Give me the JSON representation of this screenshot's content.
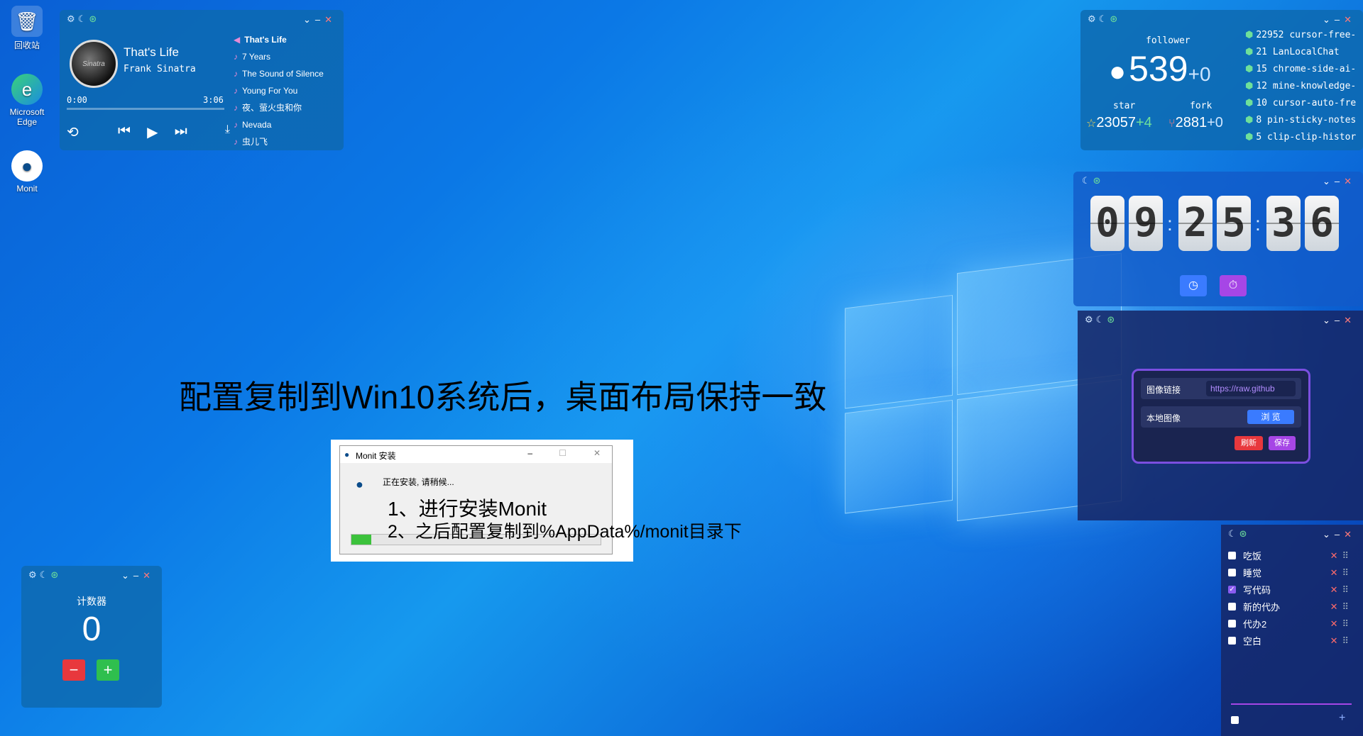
{
  "desktop_icons": [
    {
      "label": "回收站",
      "glyph": "🗑"
    },
    {
      "label": "Microsoft Edge",
      "glyph": "e"
    },
    {
      "label": "Monit",
      "glyph": "●"
    }
  ],
  "music": {
    "title": "That's Life",
    "artist": "Frank Sinatra",
    "album_text": "Sinatra",
    "time_current": "0:00",
    "time_total": "3:06",
    "progress": 0,
    "playlist": [
      "That's Life",
      "7 Years",
      "The Sound of Silence",
      "Young For You",
      "夜、萤火虫和你",
      "Nevada",
      "虫儿飞"
    ],
    "controls": [
      "repeat-icon",
      "previous-icon",
      "play-icon",
      "next-icon",
      "download-icon"
    ]
  },
  "github": {
    "follower_label": "follower",
    "follower_count": "539",
    "follower_delta": "+0",
    "star_label": "star",
    "star_count": "23057",
    "star_delta": "+4",
    "fork_label": "fork",
    "fork_count": "2881",
    "fork_delta": "+0",
    "repos": [
      {
        "stars": "22952",
        "name": "cursor-free-"
      },
      {
        "stars": "21",
        "name": "LanLocalChat"
      },
      {
        "stars": "15",
        "name": "chrome-side-ai-"
      },
      {
        "stars": "12",
        "name": "mine-knowledge-"
      },
      {
        "stars": "10",
        "name": "cursor-auto-fre"
      },
      {
        "stars": "8",
        "name": "pin-sticky-notes"
      },
      {
        "stars": "5",
        "name": "clip-clip-histor"
      }
    ]
  },
  "clock": {
    "digits": [
      "0",
      "9",
      "2",
      "5",
      "3",
      "6"
    ],
    "buttons": [
      "clock-icon",
      "timer-icon"
    ]
  },
  "image_widget": {
    "url_label": "图像链接",
    "url_value": "https://raw.github",
    "local_label": "本地图像",
    "browse_label": "浏 览",
    "refresh_label": "刷新",
    "save_label": "保存"
  },
  "counter": {
    "title": "计数器",
    "value": "0",
    "minus": "−",
    "plus": "+"
  },
  "todos": [
    {
      "text": "吃饭",
      "done": false
    },
    {
      "text": "睡觉",
      "done": false
    },
    {
      "text": "写代码",
      "done": true
    },
    {
      "text": "新的代办",
      "done": false
    },
    {
      "text": "代办2",
      "done": false
    },
    {
      "text": "空白",
      "done": false
    }
  ],
  "todo_add": "+",
  "caption": "配置复制到Win10系统后，桌面布局保持一致",
  "installer": {
    "title": "Monit 安装",
    "status": "正在安装, 请稍候...",
    "step1": "1、进行安装Monit",
    "step2": "2、之后配置复制到%AppData%/monit目录下",
    "progress": 0.08
  },
  "colors": {
    "accent_red": "#e8383d",
    "accent_green": "#2fbf4e",
    "accent_purple": "#a646e6",
    "accent_blue": "#3a7bff"
  }
}
